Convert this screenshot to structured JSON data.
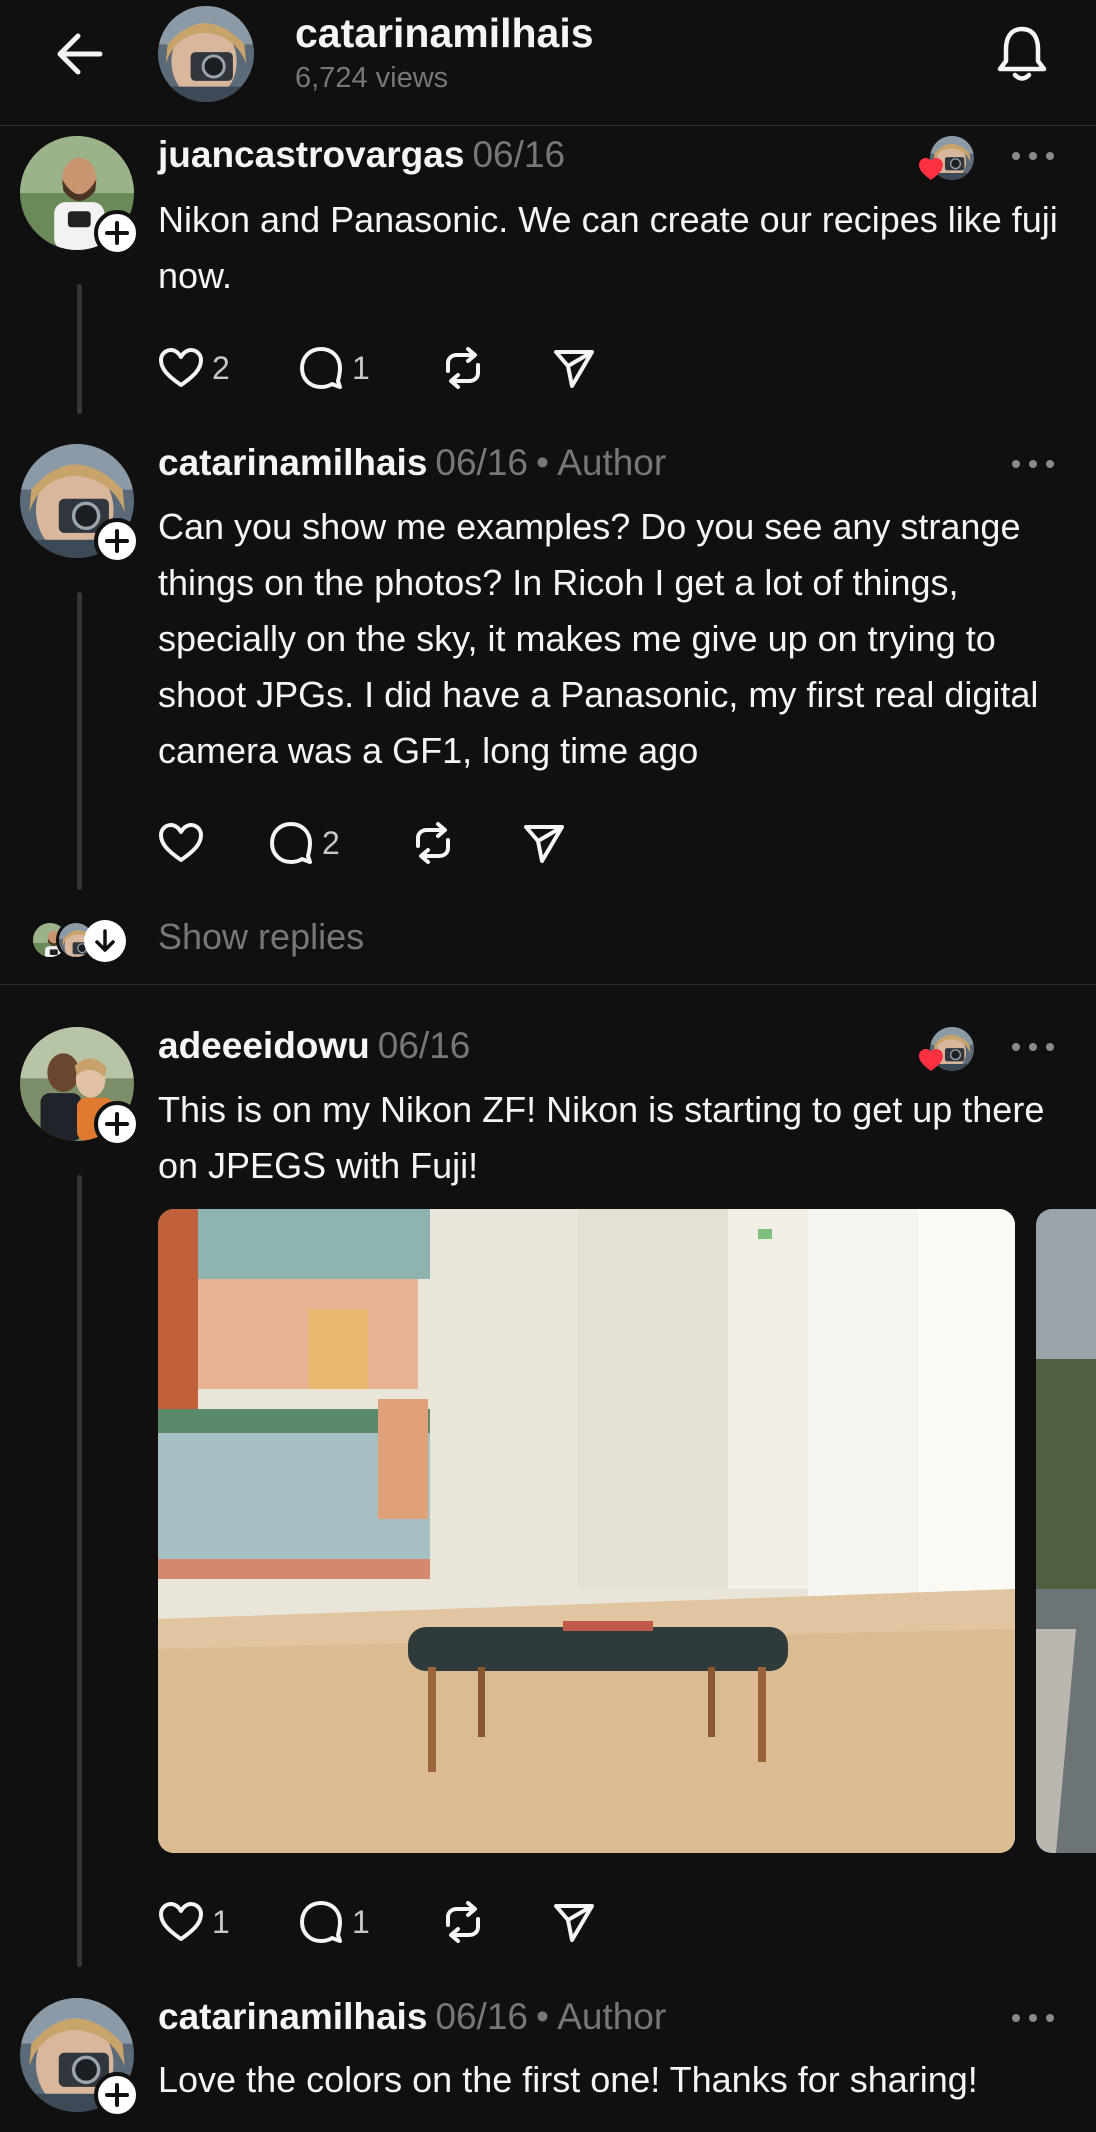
{
  "header": {
    "title": "catarinamilhais",
    "views": "6,724 views"
  },
  "colors": {
    "background": "#101010",
    "text": "#f3f5f7",
    "muted": "#777777",
    "heart": "#ff3040"
  },
  "posts": [
    {
      "username": "juancastrovargas",
      "date": "06/16",
      "author_tag": "",
      "text": "Nikon and Panasonic. We can create our recipes like fuji now.",
      "likes": "2",
      "replies": "1"
    },
    {
      "username": "catarinamilhais",
      "date": "06/16",
      "author_tag": "• Author",
      "text": "Can you show me examples? Do you see any strange things on the photos? In Ricoh I get a lot of things, specially on the sky, it makes me give up on trying to shoot JPGs. I did have a Panasonic, my first real digital camera was a GF1, long time ago",
      "likes": "",
      "replies": "2"
    },
    {
      "username": "adeeeidowu",
      "date": "06/16",
      "author_tag": "",
      "text": "This is on my Nikon ZF! Nikon is starting to get up there on JPEGS with Fuji!",
      "likes": "1",
      "replies": "1"
    },
    {
      "username": "catarinamilhais",
      "date": "06/16",
      "author_tag": "• Author",
      "text": "Love the colors on the first one! Thanks for sharing!",
      "likes": "",
      "replies": ""
    }
  ],
  "show_replies": {
    "label": "Show replies"
  },
  "icons": {
    "back": "arrow-left-icon",
    "notifications": "bell-icon",
    "like": "heart-icon",
    "reply": "comment-icon",
    "repost": "repost-icon",
    "share": "send-icon",
    "more": "more-icon",
    "follow": "plus-icon",
    "expand": "arrow-down-icon"
  }
}
